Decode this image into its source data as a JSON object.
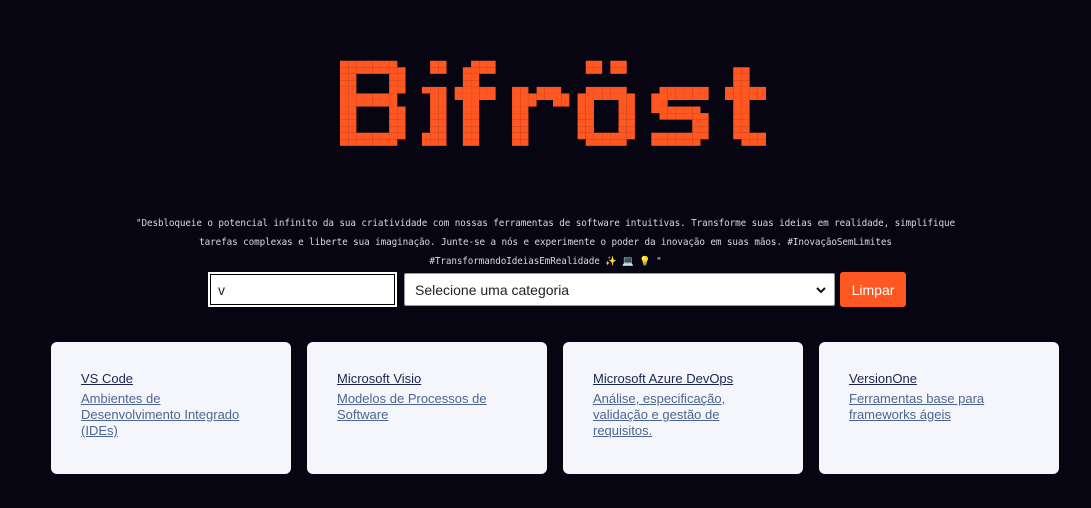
{
  "brand": {
    "name": "Bifröst",
    "color": "#ff5722"
  },
  "tagline": "\"Desbloqueie o potencial infinito da sua criatividade com nossas ferramentas de software intuitivas. Transforme suas ideias em realidade, simplifique tarefas complexas e liberte sua imaginação. Junte-se a nós e experimente o poder da inovação em suas mãos. #InovaçãoSemLimites #TransformandoIdeiasEmRealidade ✨ 💻 💡 \"",
  "search": {
    "value": "v"
  },
  "category_select": {
    "selected": "Selecione uma categoria"
  },
  "clear_button": {
    "label": "Limpar"
  },
  "cards": [
    {
      "title": "VS Code",
      "description": "Ambientes de Desenvolvimento Integrado (IDEs)"
    },
    {
      "title": "Microsoft Visio",
      "description": "Modelos de Processos de Software"
    },
    {
      "title": "Microsoft Azure DevOps",
      "description": "Análise, especificação, validação e gestão de requisitos."
    },
    {
      "title": "VersionOne",
      "description": "Ferramentas base para frameworks ágeis"
    }
  ]
}
